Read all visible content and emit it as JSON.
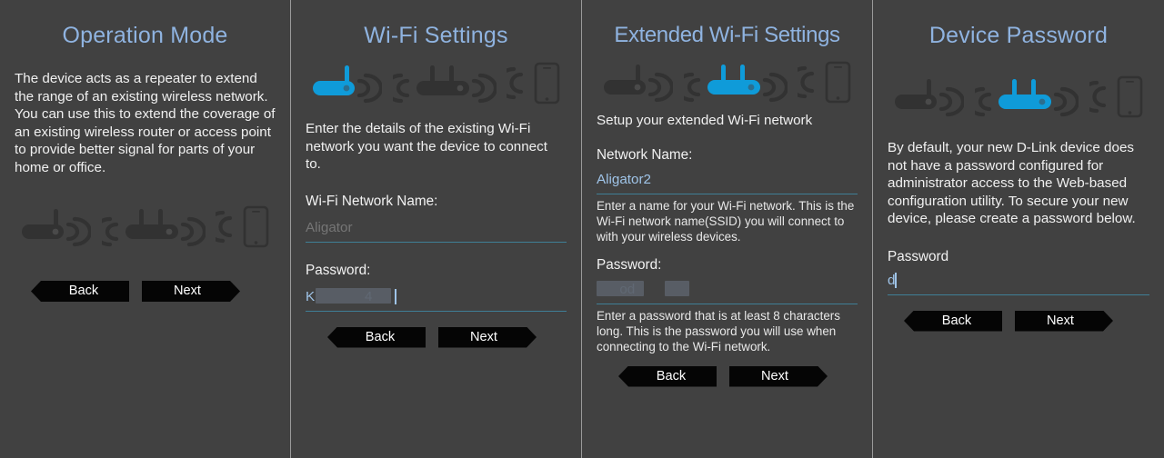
{
  "app": {
    "background_color": "#414141",
    "title_color": "#8fb3e0",
    "accent_blue": "#0f9bd9",
    "underline_color": "#3f7f96",
    "input_text_color": "#9fc4e8",
    "button_bg": "#050505"
  },
  "panels": [
    {
      "title": "Operation Mode",
      "description": "The device acts as a repeater to extend the range of an existing wireless network. You can use this to extend the coverage of an existing wireless router or access point to provide better signal for parts of your home or office.",
      "icons": {
        "router_single": "inactive",
        "router_double": "inactive",
        "phone": "inactive"
      },
      "buttons": {
        "back": "Back",
        "next": "Next"
      }
    },
    {
      "title": "Wi-Fi Settings",
      "description": "Enter the details of the existing Wi-Fi network you want the device to connect to.",
      "icons": {
        "router_single": "active",
        "router_double": "inactive",
        "phone": "inactive"
      },
      "fields": [
        {
          "label": "Wi-Fi Network Name:",
          "value": "",
          "placeholder": "Aligator",
          "state": "placeholder"
        },
        {
          "label": "Password:",
          "value": "K             4",
          "placeholder": "",
          "state": "redacted"
        }
      ],
      "buttons": {
        "back": "Back",
        "next": "Next"
      }
    },
    {
      "title": "Extended Wi-Fi Settings",
      "description": "Setup your extended Wi-Fi network",
      "icons": {
        "router_single": "inactive",
        "router_double": "active",
        "phone": "inactive"
      },
      "fields": [
        {
          "label": "Network Name:",
          "value": "Aligator2",
          "state": "filled",
          "hint": "Enter a name for your Wi-Fi network. This is the Wi-Fi network name(SSID) you will connect to with your wireless devices."
        },
        {
          "label": "Password:",
          "value": "      od      ",
          "state": "redacted",
          "hint": "Enter a password that is at least 8 characters long. This is the password you will use when connecting to the Wi-Fi network."
        }
      ],
      "buttons": {
        "back": "Back",
        "next": "Next"
      }
    },
    {
      "title": "Device Password",
      "description": "By default, your new D-Link device does not have a password configured for administrator access to the Web-based configuration utility. To secure your new device, please create a password below.",
      "icons": {
        "router_single": "inactive",
        "router_double": "active",
        "phone": "inactive"
      },
      "fields": [
        {
          "label": "Password",
          "value": "d",
          "state": "filled-caret"
        }
      ],
      "buttons": {
        "back": "Back",
        "next": "Next"
      }
    }
  ]
}
